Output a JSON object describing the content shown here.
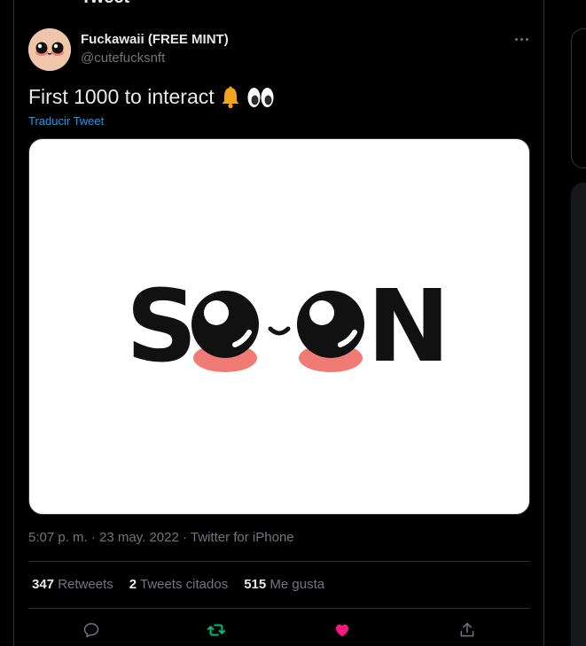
{
  "header": {
    "title": "Tweet"
  },
  "author": {
    "name": "Fuckawaii (FREE MINT)",
    "handle": "@cutefucksnft",
    "avatar_icon": "kawaii-face-avatar"
  },
  "tweet": {
    "text": "First 1000 to interact",
    "emojis": [
      "bell-icon",
      "eyes-icon"
    ],
    "translate_label": "Traducir Tweet",
    "image": {
      "wordmark": "SOON",
      "description_icon": "soon-kawaii-eyes"
    }
  },
  "meta": {
    "time": "5:07 p. m.",
    "separator": "·",
    "date": "23 may. 2022",
    "source": "Twitter for iPhone"
  },
  "stats": {
    "retweets_count": "347",
    "retweets_label": "Retweets",
    "quotes_count": "2",
    "quotes_label": "Tweets citados",
    "likes_count": "515",
    "likes_label": "Me gusta"
  },
  "colors": {
    "background": "#000000",
    "text": "#e7e9ea",
    "muted": "#71767b",
    "link": "#1d9bf0",
    "retweet": "#00ba7c",
    "like": "#f91880",
    "border": "#2f3336"
  }
}
